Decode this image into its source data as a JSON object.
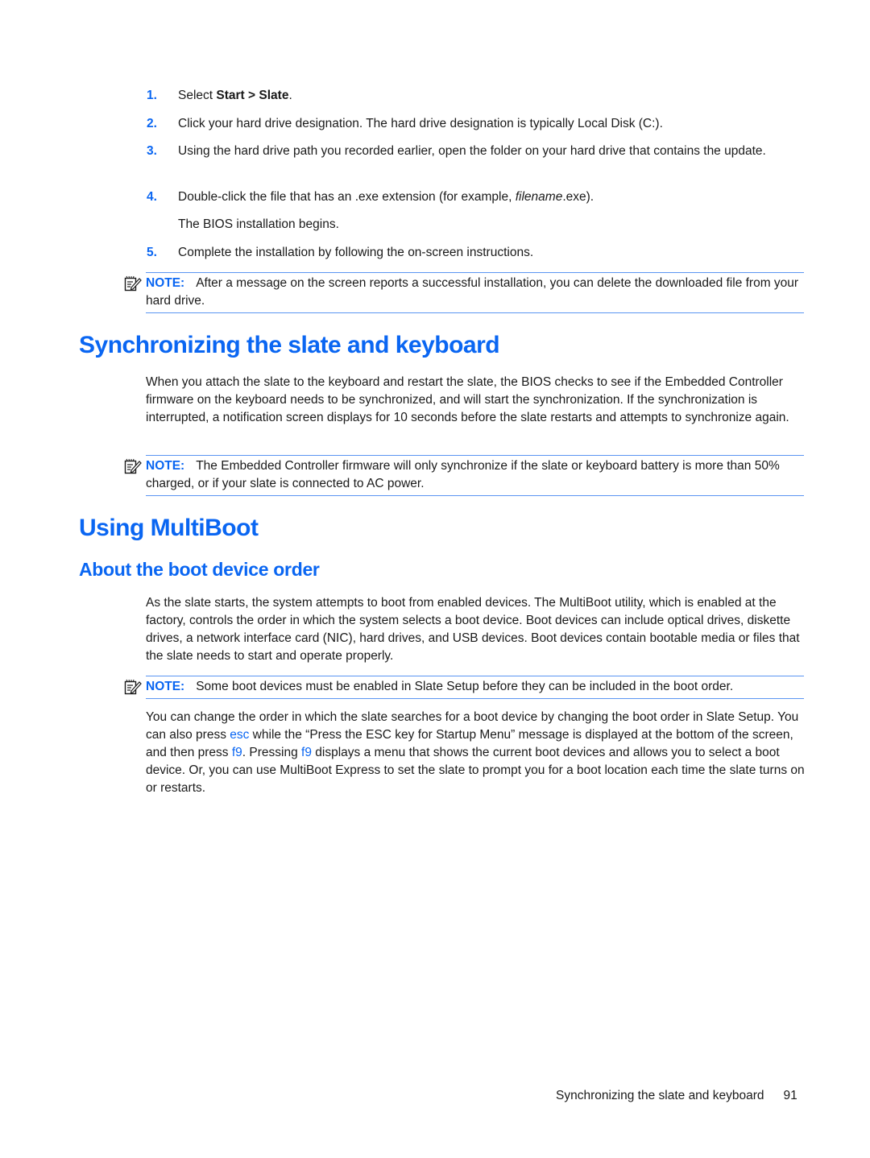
{
  "steps": [
    {
      "num": "1.",
      "pre": "Select ",
      "bold1": "Start",
      "sep": " > ",
      "bold2": "Slate",
      "post": "."
    },
    {
      "num": "2.",
      "text": "Click your hard drive designation. The hard drive designation is typically Local Disk (C:)."
    },
    {
      "num": "3.",
      "text": "Using the hard drive path you recorded earlier, open the folder on your hard drive that contains the update."
    },
    {
      "num": "4.",
      "pre": "Double-click the file that has an .exe extension (for example, ",
      "italic": "filename",
      "post": ".exe).",
      "result": "The BIOS installation begins."
    },
    {
      "num": "5.",
      "text": "Complete the installation by following the on-screen instructions."
    }
  ],
  "notes": [
    {
      "label": "NOTE:",
      "text": "After a message on the screen reports a successful installation, you can delete the downloaded file from your hard drive."
    },
    {
      "label": "NOTE:",
      "text": "The Embedded Controller firmware will only synchronize if the slate or keyboard battery is more than 50% charged, or if your slate is connected to AC power."
    },
    {
      "label": "NOTE:",
      "text": "Some boot devices must be enabled in Slate Setup before they can be included in the boot order."
    }
  ],
  "sections": {
    "sync": {
      "title": "Synchronizing the slate and keyboard",
      "paragraph": "When you attach the slate to the keyboard and restart the slate, the BIOS checks to see if the Embedded Controller firmware on the keyboard needs to be synchronized, and will start the synchronization. If the synchronization is interrupted, a notification screen displays for 10 seconds before the slate restarts and attempts to synchronize again."
    },
    "multiboot": {
      "title": "Using MultiBoot",
      "subtitle": "About the boot device order",
      "paragraph1": "As the slate starts, the system attempts to boot from enabled devices. The MultiBoot utility, which is enabled at the factory, controls the order in which the system selects a boot device. Boot devices can include optical drives, diskette drives, a network interface card (NIC), hard drives, and USB devices. Boot devices contain bootable media or files that the slate needs to start and operate properly.",
      "paragraph2": {
        "part1": "You can change the order in which the slate searches for a boot device by changing the boot order in Slate Setup. You can also press ",
        "key1": "esc",
        "part2": " while the “Press the ESC key for Startup Menu” message is displayed at the bottom of the screen, and then press ",
        "key2": "f9",
        "part3": ". Pressing ",
        "key3": "f9",
        "part4": " displays a menu that shows the current boot devices and allows you to select a boot device. Or, you can use MultiBoot Express to set the slate to prompt you for a boot location each time the slate turns on or restarts."
      }
    }
  },
  "footer": {
    "title": "Synchronizing the slate and keyboard",
    "page_number": "91"
  },
  "colors": {
    "accent": "#0a66f2",
    "rule": "#5b95f2",
    "text": "#1a1a1a"
  }
}
